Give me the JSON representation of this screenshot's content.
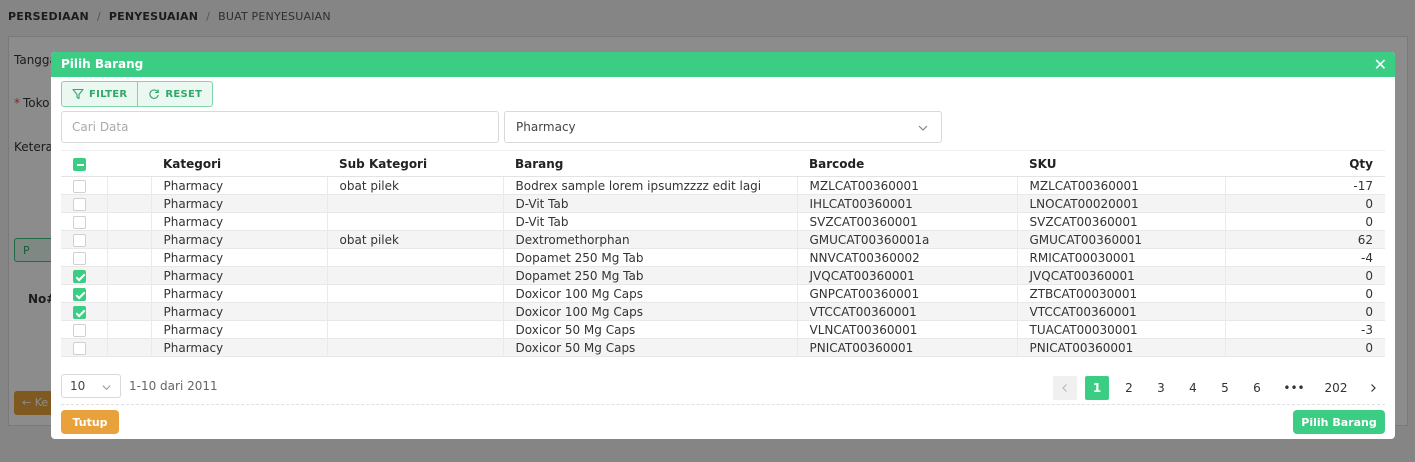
{
  "background": {
    "breadcrumb": [
      "PERSEDIAAN",
      "PENYESUAIAN",
      "BUAT PENYESUAIAN"
    ],
    "labels": [
      "Tangga",
      "Toko",
      "Keteran"
    ],
    "green_button": "P",
    "no_header": "No#",
    "orange_button": "← Ke"
  },
  "modal": {
    "title": "Pilih Barang",
    "filter_label": "FILTER",
    "reset_label": "RESET",
    "search_placeholder": "Cari Data",
    "category_select": "Pharmacy",
    "columns": {
      "kategori": "Kategori",
      "sub_kategori": "Sub Kategori",
      "barang": "Barang",
      "barcode": "Barcode",
      "sku": "SKU",
      "qty": "Qty"
    },
    "rows": [
      {
        "checked": false,
        "kategori": "Pharmacy",
        "sub_kategori": "obat pilek",
        "barang": "Bodrex sample lorem ipsumzzzz edit lagi",
        "barcode": "MZLCAT00360001",
        "sku": "MZLCAT00360001",
        "qty": "-17"
      },
      {
        "checked": false,
        "kategori": "Pharmacy",
        "sub_kategori": "",
        "barang": "D-Vit Tab",
        "barcode": "IHLCAT00360001",
        "sku": "LNOCAT00020001",
        "qty": "0"
      },
      {
        "checked": false,
        "kategori": "Pharmacy",
        "sub_kategori": "",
        "barang": "D-Vit Tab",
        "barcode": "SVZCAT00360001",
        "sku": "SVZCAT00360001",
        "qty": "0"
      },
      {
        "checked": false,
        "kategori": "Pharmacy",
        "sub_kategori": "obat pilek",
        "barang": "Dextromethorphan",
        "barcode": "GMUCAT00360001a",
        "sku": "GMUCAT00360001",
        "qty": "62"
      },
      {
        "checked": false,
        "kategori": "Pharmacy",
        "sub_kategori": "",
        "barang": "Dopamet 250 Mg Tab",
        "barcode": "NNVCAT00360002",
        "sku": "RMICAT00030001",
        "qty": "-4"
      },
      {
        "checked": true,
        "kategori": "Pharmacy",
        "sub_kategori": "",
        "barang": "Dopamet 250 Mg Tab",
        "barcode": "JVQCAT00360001",
        "sku": "JVQCAT00360001",
        "qty": "0"
      },
      {
        "checked": true,
        "kategori": "Pharmacy",
        "sub_kategori": "",
        "barang": "Doxicor 100 Mg Caps",
        "barcode": "GNPCAT00360001",
        "sku": "ZTBCAT00030001",
        "qty": "0"
      },
      {
        "checked": true,
        "kategori": "Pharmacy",
        "sub_kategori": "",
        "barang": "Doxicor 100 Mg Caps",
        "barcode": "VTCCAT00360001",
        "sku": "VTCCAT00360001",
        "qty": "0"
      },
      {
        "checked": false,
        "kategori": "Pharmacy",
        "sub_kategori": "",
        "barang": "Doxicor 50 Mg Caps",
        "barcode": "VLNCAT00360001",
        "sku": "TUACAT00030001",
        "qty": "-3"
      },
      {
        "checked": false,
        "kategori": "Pharmacy",
        "sub_kategori": "",
        "barang": "Doxicor 50 Mg Caps",
        "barcode": "PNICAT00360001",
        "sku": "PNICAT00360001",
        "qty": "0"
      }
    ],
    "page_size": "10",
    "range_info": "1-10 dari 2011",
    "pages": [
      "1",
      "2",
      "3",
      "4",
      "5",
      "6",
      "•••",
      "202"
    ],
    "current_page": "1",
    "close_button": "Tutup",
    "submit_button": "Pilih Barang",
    "accent_color": "#3ccd85",
    "secondary_color": "#e9a23b"
  }
}
